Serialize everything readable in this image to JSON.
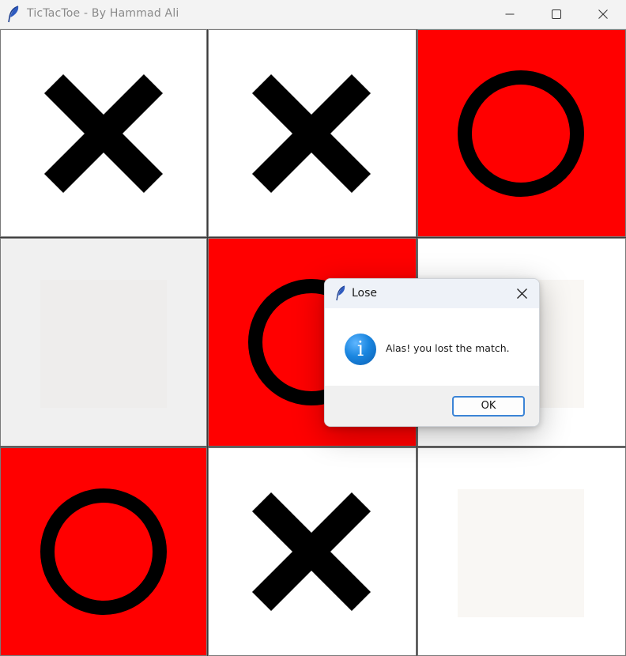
{
  "window": {
    "title": "TicTacToe - By Hammad Ali",
    "icon": "feather-icon"
  },
  "board": {
    "rows": [
      [
        {
          "mark": "X",
          "highlight": false
        },
        {
          "mark": "X",
          "highlight": false
        },
        {
          "mark": "O",
          "highlight": true
        }
      ],
      [
        {
          "mark": "",
          "highlight": false,
          "active": true
        },
        {
          "mark": "O",
          "highlight": true
        },
        {
          "mark": "",
          "highlight": false
        }
      ],
      [
        {
          "mark": "O",
          "highlight": true
        },
        {
          "mark": "X",
          "highlight": false
        },
        {
          "mark": "",
          "highlight": false
        }
      ]
    ],
    "colors": {
      "win_cell": "#ff0000",
      "empty_cell": "#ffffff",
      "mark": "#000000"
    }
  },
  "dialog": {
    "title": "Lose",
    "icon": "info-icon",
    "message": "Alas! you lost the match.",
    "ok_label": "OK",
    "accent": "#3b84d6"
  }
}
